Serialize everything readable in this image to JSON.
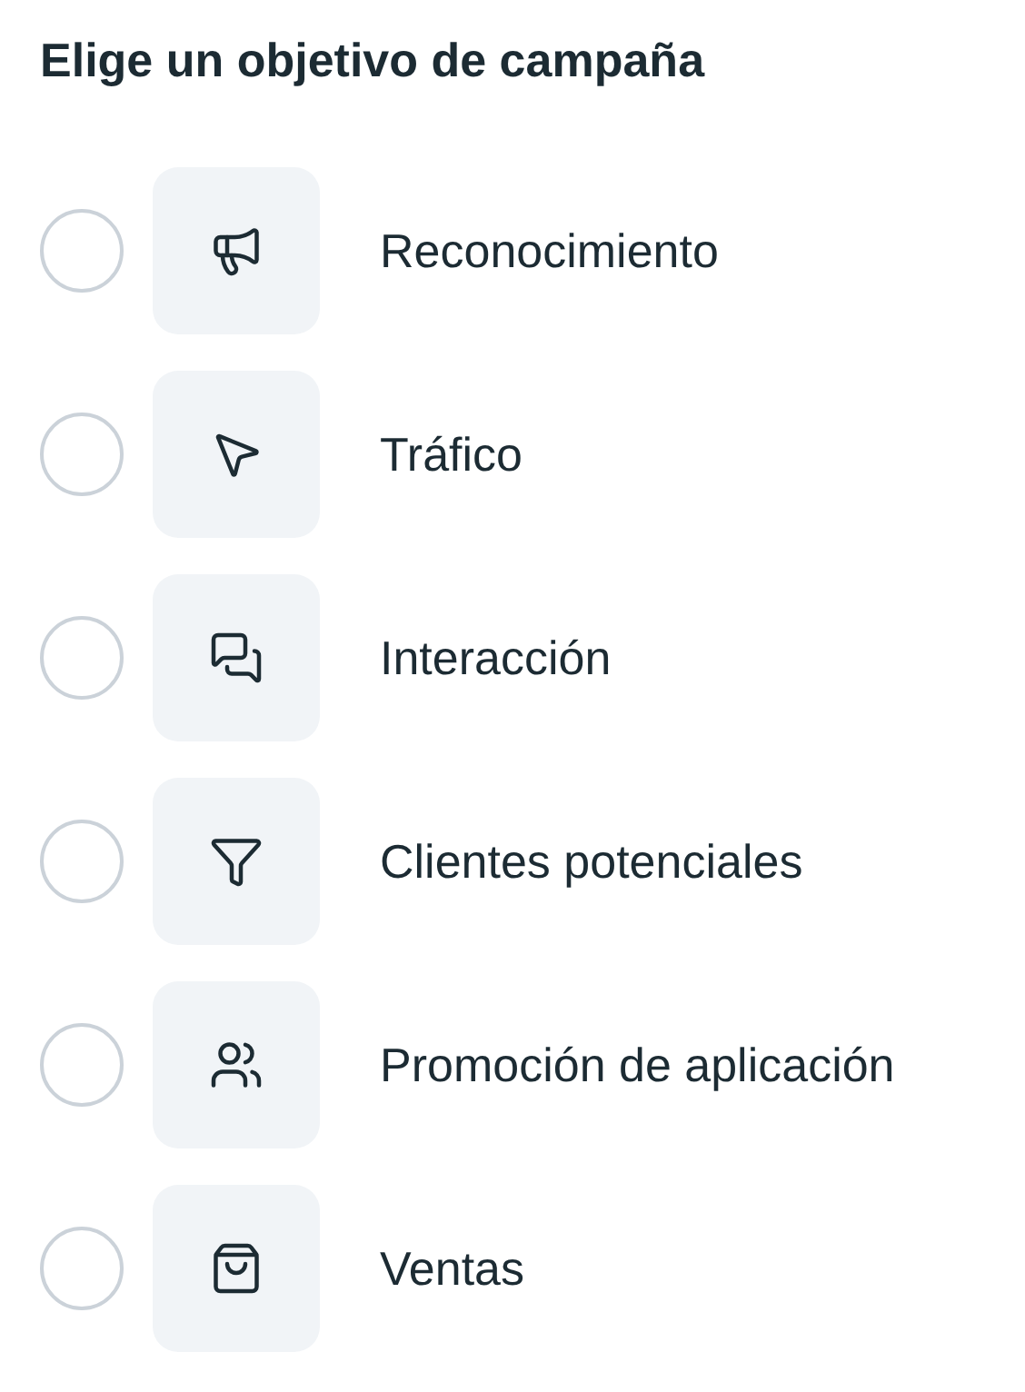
{
  "title": "Elige un objetivo de campaña",
  "objectives": [
    {
      "kind": "awareness",
      "label": "Reconocimiento",
      "selected": false
    },
    {
      "kind": "traffic",
      "label": "Tráfico",
      "selected": false
    },
    {
      "kind": "engagement",
      "label": "Interacción",
      "selected": false
    },
    {
      "kind": "leads",
      "label": "Clientes potenciales",
      "selected": false
    },
    {
      "kind": "app",
      "label": "Promoción de aplicación",
      "selected": false
    },
    {
      "kind": "sales",
      "label": "Ventas",
      "selected": false
    }
  ]
}
